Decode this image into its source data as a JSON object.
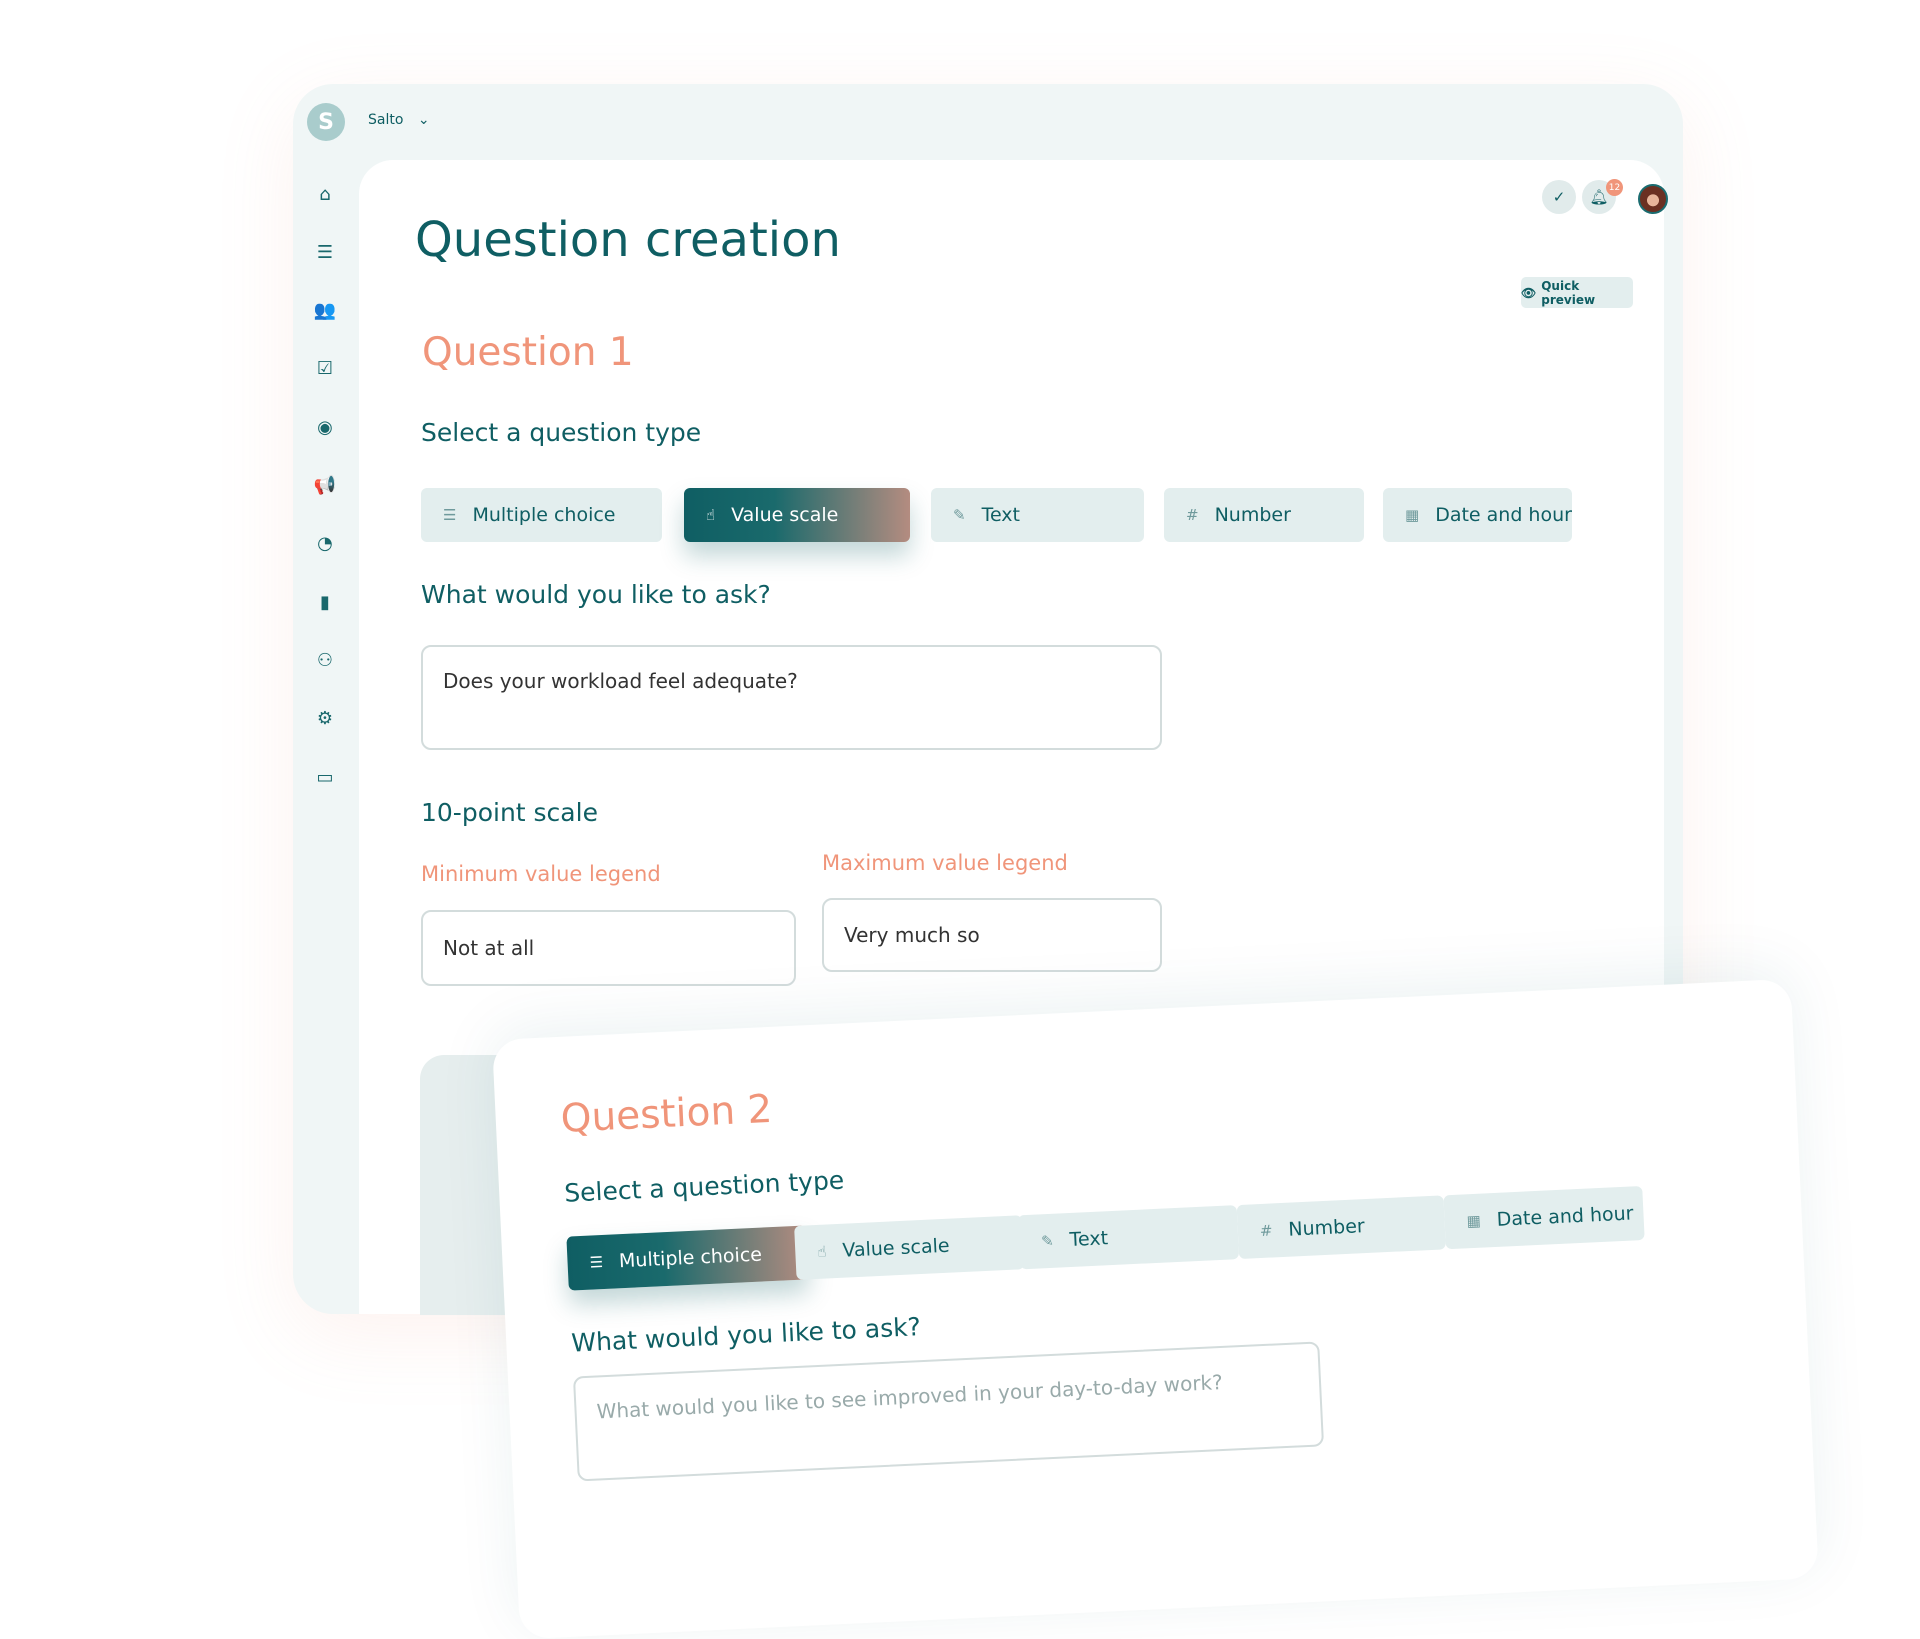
{
  "header": {
    "logo_letter": "S",
    "workspace": "Salto",
    "chevron": "⌄",
    "notification_count": "12"
  },
  "sidebar": {
    "icons": [
      "home-icon",
      "list-icon",
      "users-icon",
      "checklist-icon",
      "chat-icon",
      "megaphone-icon",
      "timer-icon",
      "bar-chart-icon",
      "groups-icon",
      "gear-icon",
      "credit-card-icon"
    ],
    "glyphs": [
      "⌂",
      "☰",
      "👥",
      "☑",
      "◉",
      "📢",
      "◔",
      "▮",
      "⚇",
      "⚙",
      "▭"
    ]
  },
  "page": {
    "title": "Question creation",
    "quick_preview": "Quick preview"
  },
  "question_types": [
    "Multiple choice",
    "Value scale",
    "Text",
    "Number",
    "Date and hour"
  ],
  "q1": {
    "heading": "Question 1",
    "select_type": "Select a question type",
    "selected": "Value scale",
    "ask_label": "What would you like to ask?",
    "ask_value": "Does your workload feel adequate?",
    "scale_label": "10-point scale",
    "min_label": "Minimum value legend",
    "min_value": "Not at all",
    "max_label": "Maximum value legend",
    "max_value": "Very much so"
  },
  "q2": {
    "heading": "Question 2",
    "select_type": "Select a question type",
    "selected": "Multiple choice",
    "ask_label": "What would you like to ask?",
    "ask_placeholder": "What would you like to see improved in your day-to-day work?"
  },
  "colors": {
    "primary": "#0f5e63",
    "accent": "#f0957a",
    "surface": "#f0f6f6"
  }
}
